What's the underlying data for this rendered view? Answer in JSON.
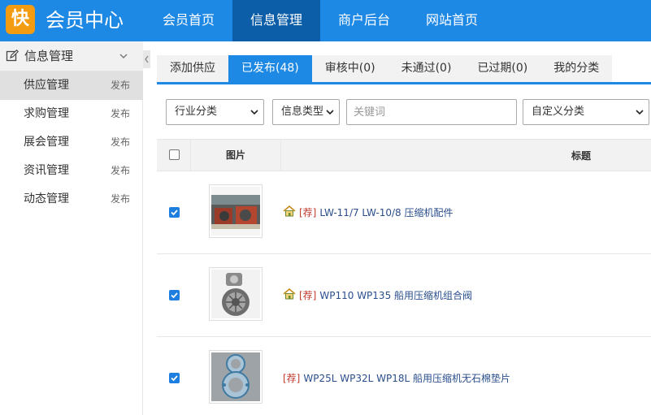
{
  "header": {
    "logo_char": "快",
    "title": "会员中心",
    "nav": [
      {
        "label": "会员首页",
        "active": false
      },
      {
        "label": "信息管理",
        "active": true
      },
      {
        "label": "商户后台",
        "active": false
      },
      {
        "label": "网站首页",
        "active": false
      }
    ]
  },
  "sidebar": {
    "heading": "信息管理",
    "items": [
      {
        "label": "供应管理",
        "action": "发布",
        "active": true
      },
      {
        "label": "求购管理",
        "action": "发布",
        "active": false
      },
      {
        "label": "展会管理",
        "action": "发布",
        "active": false
      },
      {
        "label": "资讯管理",
        "action": "发布",
        "active": false
      },
      {
        "label": "动态管理",
        "action": "发布",
        "active": false
      }
    ]
  },
  "tabs": [
    {
      "label": "添加供应",
      "active": false
    },
    {
      "label": "已发布(48)",
      "active": true
    },
    {
      "label": "审核中(0)",
      "active": false
    },
    {
      "label": "未通过(0)",
      "active": false
    },
    {
      "label": "已过期(0)",
      "active": false
    },
    {
      "label": "我的分类",
      "active": false
    }
  ],
  "filters": {
    "industry": "行业分类",
    "info_type": "信息类型",
    "keyword_placeholder": "关键词",
    "custom": "自定义分类"
  },
  "table": {
    "col_image": "图片",
    "col_title": "标题",
    "rows": [
      {
        "checked": true,
        "home": true,
        "tag": "[荐]",
        "title": "LW-11/7 LW-10/8 压缩机配件"
      },
      {
        "checked": true,
        "home": true,
        "tag": "[荐]",
        "title": "WP110 WP135 船用压缩机组合阀"
      },
      {
        "checked": true,
        "home": false,
        "tag": "[荐]",
        "title": "WP25L WP32L WP18L 船用压缩机无石棉垫片"
      }
    ]
  },
  "colors": {
    "primary": "#1e88e5",
    "nav_active": "#0d5ea8",
    "logo": "#f39c12",
    "tag_red": "#c0392b",
    "link": "#2a4e8c"
  }
}
